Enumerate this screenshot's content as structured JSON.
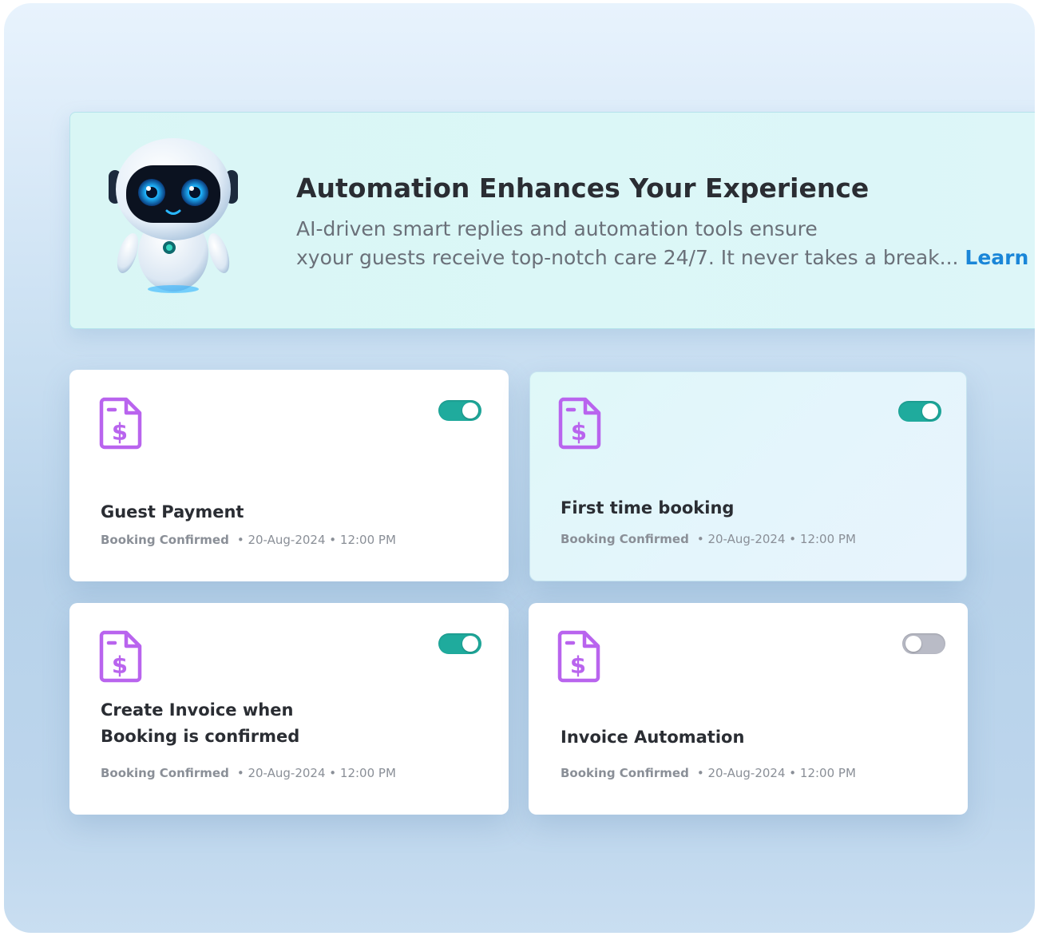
{
  "banner": {
    "title": "Automation Enhances Your Experience",
    "description_line1": "AI-driven smart replies and automation tools ensure",
    "description_line2": "xyour guests receive top-notch care 24/7. It never takes a break...",
    "learn_more": "Learn More"
  },
  "cards": [
    {
      "title": "Guest Payment",
      "status": "Booking Confirmed",
      "datetime": "• 20-Aug-2024 • 12:00 PM",
      "toggle_on": true,
      "icon": "invoice-dollar-icon"
    },
    {
      "title": "First time booking",
      "status": "Booking Confirmed",
      "datetime": "• 20-Aug-2024 • 12:00 PM",
      "toggle_on": true,
      "icon": "invoice-dollar-icon"
    },
    {
      "title_line1": "Create Invoice when",
      "title_line2": "Booking is confirmed",
      "status": "Booking Confirmed",
      "datetime": "• 20-Aug-2024 • 12:00 PM",
      "toggle_on": true,
      "icon": "invoice-dollar-icon"
    },
    {
      "title": "Invoice Automation",
      "status": "Booking Confirmed",
      "datetime": "• 20-Aug-2024 • 12:00 PM",
      "toggle_on": false,
      "icon": "invoice-dollar-icon"
    }
  ],
  "colors": {
    "accent_teal": "#1fab9d",
    "toggle_off": "#b9bbc6",
    "icon_purple": "#b964ee",
    "link_blue": "#1a86d8"
  }
}
